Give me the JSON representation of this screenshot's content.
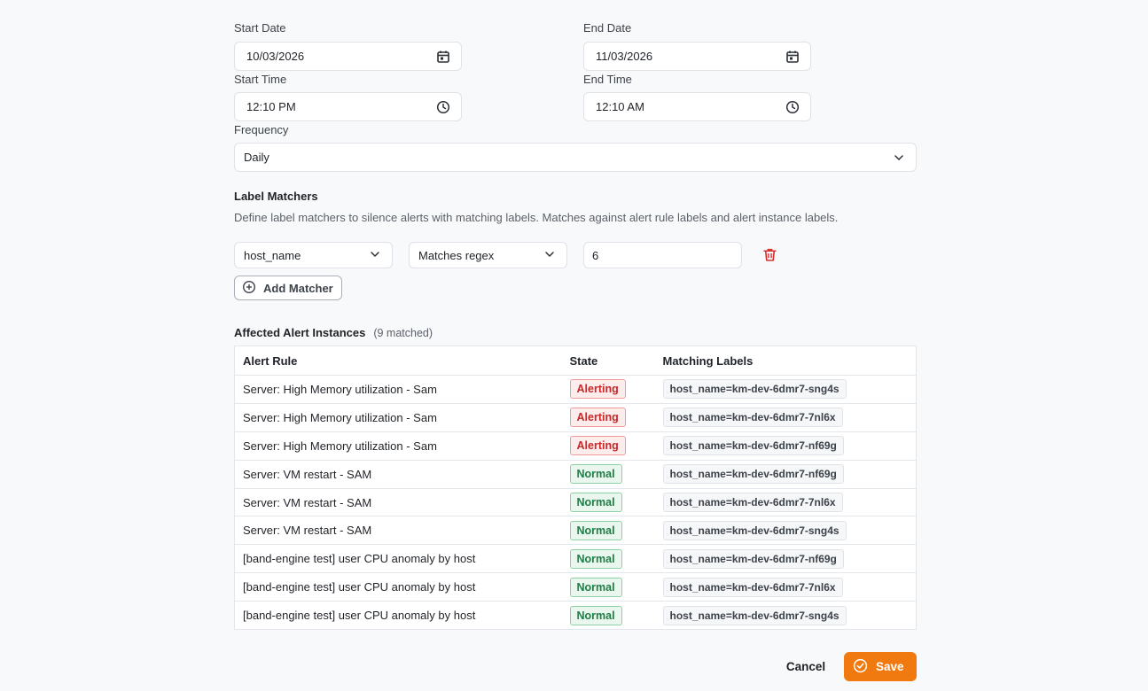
{
  "schedule": {
    "start_date_label": "Start Date",
    "start_date_value": "10/03/2026",
    "end_date_label": "End Date",
    "end_date_value": "11/03/2026",
    "start_time_label": "Start Time",
    "start_time_value": "12:10 PM",
    "end_time_label": "End Time",
    "end_time_value": "12:10 AM",
    "frequency_label": "Frequency",
    "frequency_value": "Daily"
  },
  "label_matchers": {
    "title": "Label Matchers",
    "description": "Define label matchers to silence alerts with matching labels. Matches against alert rule labels and alert instance labels.",
    "matchers": [
      {
        "label": "host_name",
        "operator": "Matches regex",
        "value": "6"
      }
    ],
    "add_matcher_label": "Add Matcher"
  },
  "affected": {
    "title": "Affected Alert Instances",
    "count_text": "(9 matched)",
    "columns": [
      "Alert Rule",
      "State",
      "Matching Labels"
    ],
    "rows": [
      {
        "rule": "Server: High Memory utilization - Sam",
        "state": "Alerting",
        "label": "host_name=km-dev-6dmr7-sng4s"
      },
      {
        "rule": "Server: High Memory utilization - Sam",
        "state": "Alerting",
        "label": "host_name=km-dev-6dmr7-7nl6x"
      },
      {
        "rule": "Server: High Memory utilization - Sam",
        "state": "Alerting",
        "label": "host_name=km-dev-6dmr7-nf69g"
      },
      {
        "rule": "Server: VM restart - SAM",
        "state": "Normal",
        "label": "host_name=km-dev-6dmr7-nf69g"
      },
      {
        "rule": "Server: VM restart - SAM",
        "state": "Normal",
        "label": "host_name=km-dev-6dmr7-7nl6x"
      },
      {
        "rule": "Server: VM restart - SAM",
        "state": "Normal",
        "label": "host_name=km-dev-6dmr7-sng4s"
      },
      {
        "rule": "[band-engine test] user CPU anomaly by host",
        "state": "Normal",
        "label": "host_name=km-dev-6dmr7-nf69g"
      },
      {
        "rule": "[band-engine test] user CPU anomaly by host",
        "state": "Normal",
        "label": "host_name=km-dev-6dmr7-7nl6x"
      },
      {
        "rule": "[band-engine test] user CPU anomaly by host",
        "state": "Normal",
        "label": "host_name=km-dev-6dmr7-sng4s"
      }
    ]
  },
  "actions": {
    "cancel_label": "Cancel",
    "save_label": "Save"
  },
  "colors": {
    "accent": "#f07a10",
    "delete": "#d32f2f",
    "alerting": "#c62828",
    "normal": "#1e7e45"
  },
  "icons": {
    "date": "calendar-icon",
    "time": "clock-icon",
    "dropdown": "chevron-down-icon",
    "delete": "trash-icon",
    "add": "plus-circle-icon",
    "save": "check-circle-icon"
  }
}
